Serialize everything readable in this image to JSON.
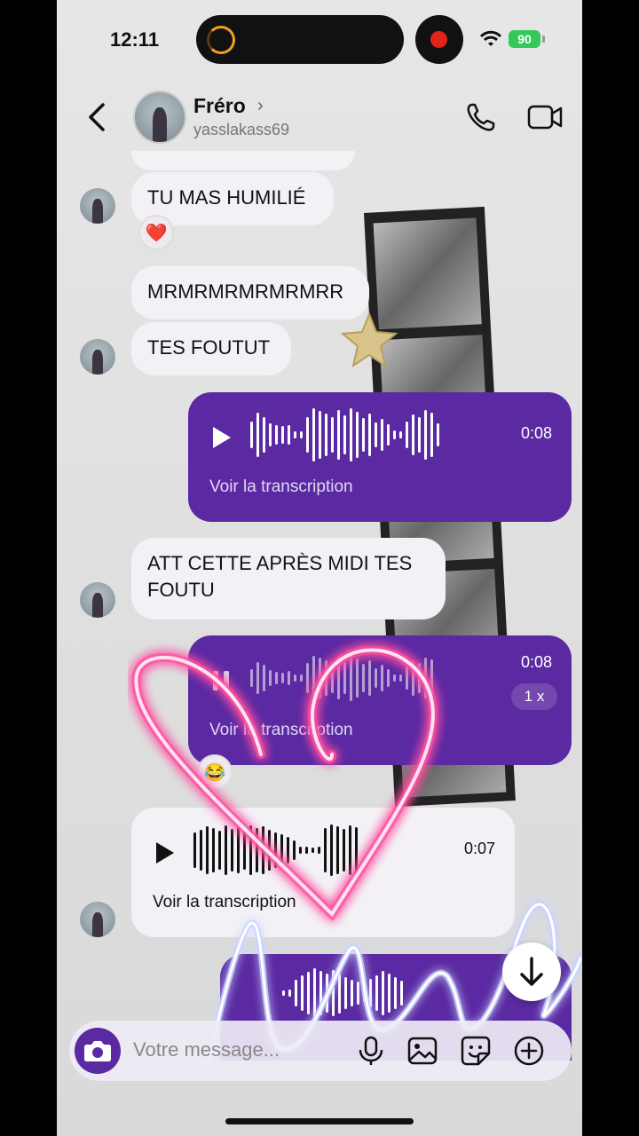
{
  "status": {
    "time": "12:11",
    "battery": "90"
  },
  "header": {
    "name": "Fréro",
    "username": "yasslakass69"
  },
  "messages": {
    "m1": "TU MAS HUMILIÉ",
    "m1_reaction": "❤️",
    "m2": "MRMRMRMRMRMRR",
    "m3": "TES FOUTUT",
    "m4_line1": "ATT CETTE APRÈS MIDI TES",
    "m4_line2": "FOUTU"
  },
  "voice": {
    "v1": {
      "duration": "0:08",
      "transcript": "Voir la transcription"
    },
    "v2": {
      "duration": "0:08",
      "transcript": "Voir la transcription",
      "speed": "1 x",
      "reaction": "😂"
    },
    "v3": {
      "duration": "0:07",
      "transcript": "Voir la transcription"
    }
  },
  "composer": {
    "placeholder": "Votre message..."
  },
  "icons": [
    "back-icon",
    "phone-icon",
    "video-icon",
    "play-icon",
    "pause-icon",
    "arrow-down-icon",
    "camera-icon",
    "microphone-icon",
    "image-icon",
    "sticker-icon",
    "plus-icon"
  ],
  "colors": {
    "accent": "#5b2aa2",
    "bubble": "#f3f1f5",
    "neon_pink": "#ff4fa0"
  }
}
